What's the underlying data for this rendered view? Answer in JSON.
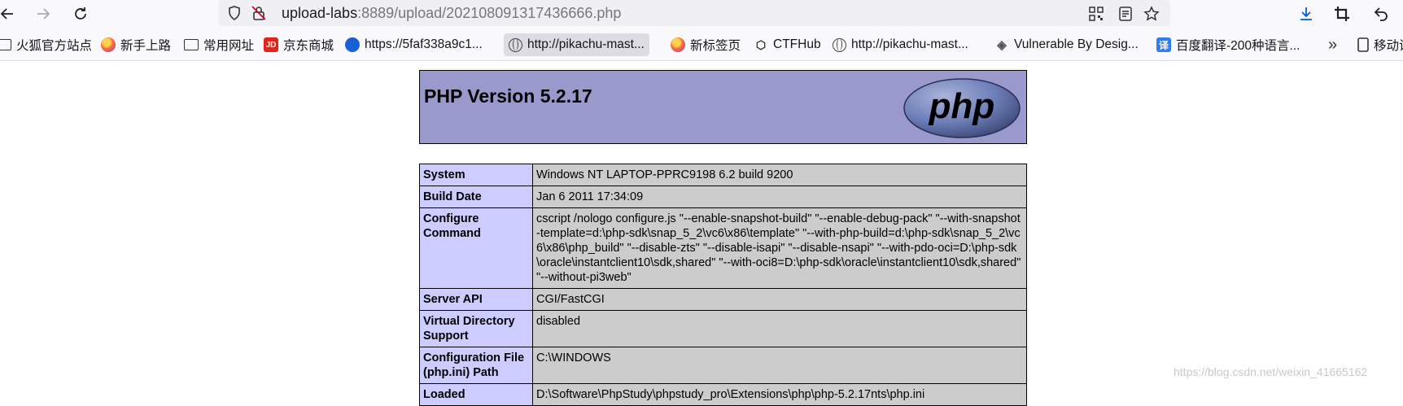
{
  "browser": {
    "url_host": "upload-labs",
    "url_rest": ":8889/upload/202108091317436666.php"
  },
  "bookmarks": [
    {
      "label": "火狐官方站点",
      "icon": "folder-icon"
    },
    {
      "label": "新手上路",
      "icon": "firefox-icon"
    },
    {
      "label": "常用网址",
      "icon": "folder-icon"
    },
    {
      "label": "京东商城",
      "icon": "jd-icon"
    },
    {
      "label": "https://5faf338a9c1...",
      "icon": "bookmark-site-icon"
    },
    {
      "label": "http://pikachu-mast...",
      "icon": "globe-icon"
    },
    {
      "label": "新标签页",
      "icon": "firefox-icon"
    },
    {
      "label": "CTFHub",
      "icon": "ctfhub-icon"
    },
    {
      "label": "http://pikachu-mast...",
      "icon": "globe-icon"
    },
    {
      "label": "Vulnerable By Desig...",
      "icon": "vulnhub-icon"
    },
    {
      "label": "百度翻译-200种语言...",
      "icon": "translate-icon"
    },
    {
      "label": "移动设",
      "icon": "mobile-icon"
    }
  ],
  "phpinfo": {
    "title": "PHP Version 5.2.17",
    "logo_text": "php",
    "rows": [
      {
        "key": "System",
        "value": "Windows NT LAPTOP-PPRC9198 6.2 build 9200"
      },
      {
        "key": "Build Date",
        "value": "Jan 6 2011 17:34:09"
      },
      {
        "key": "Configure Command",
        "value": "cscript /nologo configure.js \"--enable-snapshot-build\" \"--enable-debug-pack\" \"--with-snapshot-template=d:\\php-sdk\\snap_5_2\\vc6\\x86\\template\" \"--with-php-build=d:\\php-sdk\\snap_5_2\\vc6\\x86\\php_build\" \"--disable-zts\" \"--disable-isapi\" \"--disable-nsapi\" \"--with-pdo-oci=D:\\php-sdk\\oracle\\instantclient10\\sdk,shared\" \"--with-oci8=D:\\php-sdk\\oracle\\instantclient10\\sdk,shared\" \"--without-pi3web\""
      },
      {
        "key": "Server API",
        "value": "CGI/FastCGI"
      },
      {
        "key": "Virtual Directory Support",
        "value": "disabled"
      },
      {
        "key": "Configuration File (php.ini) Path",
        "value": "C:\\WINDOWS"
      },
      {
        "key": "Loaded",
        "value": "D:\\Software\\PhpStudy\\phpstudy_pro\\Extensions\\php\\php-5.2.17nts\\php.ini"
      }
    ]
  },
  "watermark": "https://blog.csdn.net/weixin_41665162"
}
